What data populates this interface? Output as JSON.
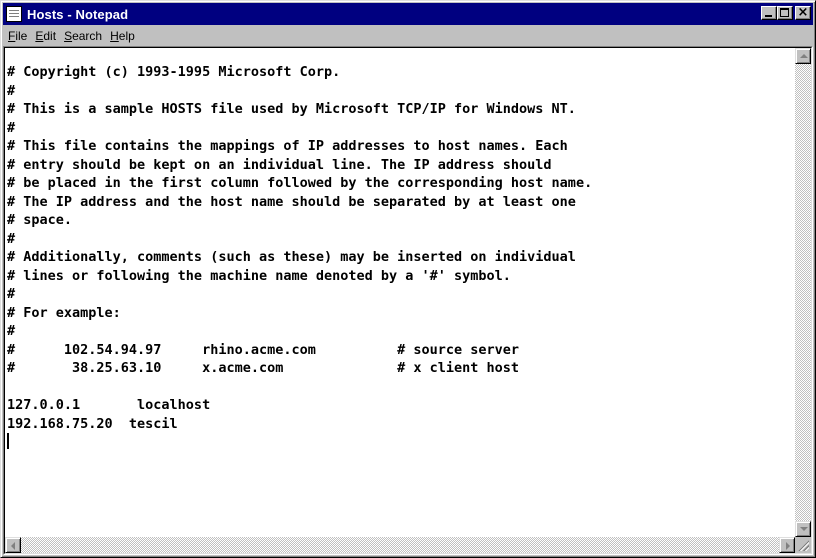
{
  "window": {
    "title": "Hosts - Notepad",
    "titlebar_color": "#000080"
  },
  "menu": [
    {
      "pre": "",
      "key": "F",
      "rest": "ile"
    },
    {
      "pre": "",
      "key": "E",
      "rest": "dit"
    },
    {
      "pre": "",
      "key": "S",
      "rest": "earch"
    },
    {
      "pre": "",
      "key": "H",
      "rest": "elp"
    }
  ],
  "editor": {
    "lines": [
      "# Copyright (c) 1993-1995 Microsoft Corp.",
      "#",
      "# This is a sample HOSTS file used by Microsoft TCP/IP for Windows NT.",
      "#",
      "# This file contains the mappings of IP addresses to host names. Each",
      "# entry should be kept on an individual line. The IP address should",
      "# be placed in the first column followed by the corresponding host name.",
      "# The IP address and the host name should be separated by at least one",
      "# space.",
      "#",
      "# Additionally, comments (such as these) may be inserted on individual",
      "# lines or following the machine name denoted by a '#' symbol.",
      "#",
      "# For example:",
      "#",
      "#      102.54.94.97     rhino.acme.com          # source server",
      "#       38.25.63.10     x.acme.com              # x client host",
      "",
      "127.0.0.1       localhost",
      "192.168.75.20  tescil"
    ]
  },
  "icons": {
    "app": "notepad-icon",
    "minimize": "minimize-icon",
    "maximize": "maximize-icon",
    "close": "close-icon"
  }
}
